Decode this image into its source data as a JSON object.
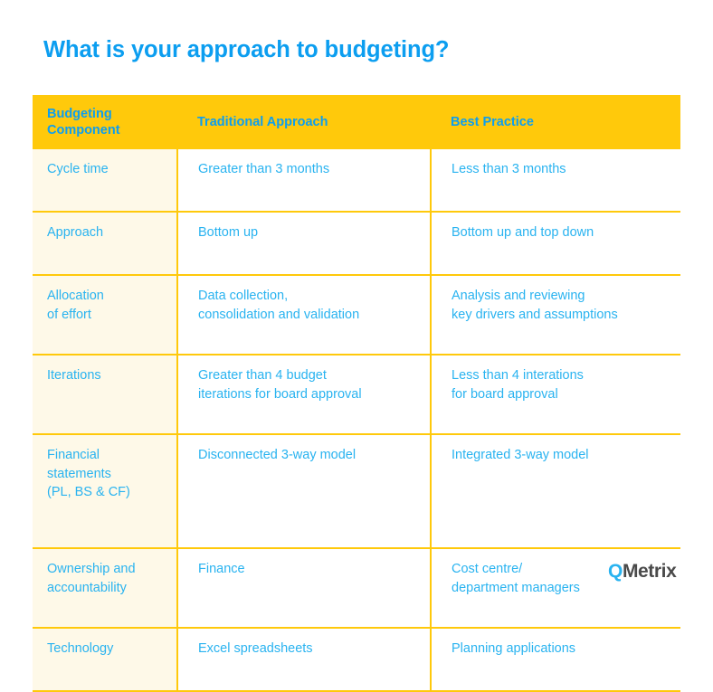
{
  "page": {
    "title": "What is your approach to budgeting?",
    "background": "#ffffff"
  },
  "colors": {
    "title_blue": "#0C9EF0",
    "header_text_blue": "#0C9EF0",
    "body_text_blue": "#29B3F0",
    "header_background_yellow": "#FFC90B",
    "border_yellow": "#FFC90B",
    "first_column_cream": "#FEF9E8",
    "logo_q_blue": "#29B3F0",
    "logo_text_gray": "#4A4A4A"
  },
  "table": {
    "headers": {
      "col1_line1": "Budgeting",
      "col1_line2": "Component",
      "col2": "Traditional Approach",
      "col3": "Best Practice"
    },
    "rows": [
      {
        "component": [
          "Cycle time"
        ],
        "traditional": [
          "Greater than 3 months"
        ],
        "best_practice": [
          "Less than 3 months"
        ]
      },
      {
        "component": [
          "Approach"
        ],
        "traditional": [
          "Bottom up"
        ],
        "best_practice": [
          "Bottom up and top down"
        ]
      },
      {
        "component": [
          "Allocation",
          "of effort"
        ],
        "traditional": [
          "Data collection,",
          "consolidation and validation"
        ],
        "best_practice": [
          "Analysis and reviewing",
          "key drivers and assumptions"
        ]
      },
      {
        "component": [
          "Iterations"
        ],
        "traditional": [
          "Greater than 4 budget",
          "iterations for board approval"
        ],
        "best_practice": [
          "Less than 4 interations",
          "for board approval"
        ]
      },
      {
        "component": [
          "Financial",
          "statements",
          "(PL, BS & CF)"
        ],
        "traditional": [
          "Disconnected 3-way model"
        ],
        "best_practice": [
          "Integrated 3-way model"
        ]
      },
      {
        "component": [
          "Ownership and",
          "accountability"
        ],
        "traditional": [
          "Finance"
        ],
        "best_practice": [
          "Cost centre/",
          "department managers"
        ]
      },
      {
        "component": [
          "Technology"
        ],
        "traditional": [
          "Excel spreadsheets"
        ],
        "best_practice": [
          "Planning applications"
        ]
      }
    ]
  },
  "logo": {
    "mark": "Q",
    "wordmark": "Metrix"
  }
}
